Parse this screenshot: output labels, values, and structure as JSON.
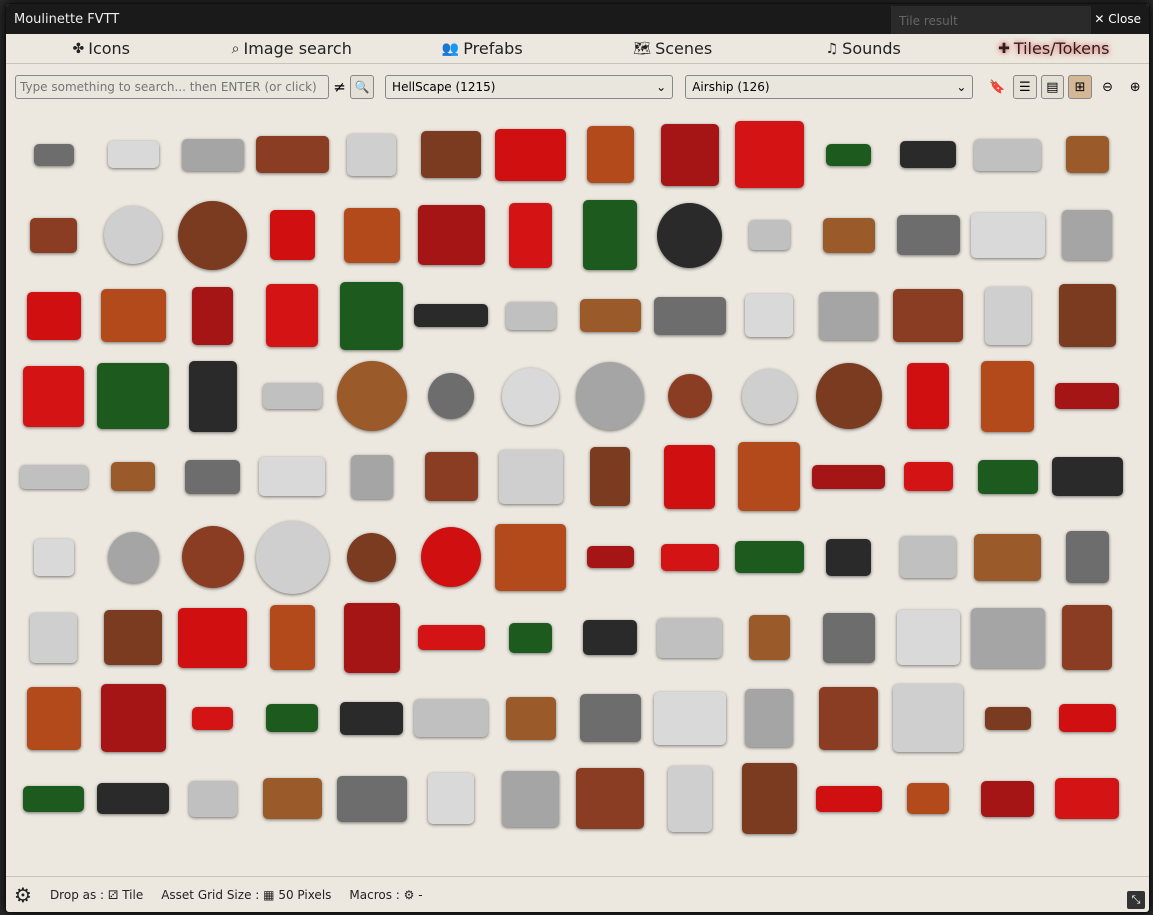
{
  "window": {
    "title": "Moulinette FVTT",
    "ghost_text": "Tile result",
    "close_label": "Close"
  },
  "tabs": [
    {
      "label": "Icons",
      "icon": "icons-icon"
    },
    {
      "label": "Image search",
      "icon": "search-icon"
    },
    {
      "label": "Prefabs",
      "icon": "users-icon"
    },
    {
      "label": "Scenes",
      "icon": "map-icon"
    },
    {
      "label": "Sounds",
      "icon": "music-icon"
    },
    {
      "label": "Tiles/Tokens",
      "icon": "puzzle-icon",
      "active": true
    }
  ],
  "toolbar": {
    "search_placeholder": "Type something to search... then ENTER (or click)",
    "neq": "≠",
    "pack": "HellScape (1215)",
    "category": "Airship (126)"
  },
  "grid": {
    "columns": 14,
    "rows": 9,
    "colors": [
      "#6d6d6d",
      "#d9d9d9",
      "#a5a5a5",
      "#8a3d22",
      "#cfcfcf",
      "#7a3b20",
      "#d01010",
      "#c1501a",
      "#a51515",
      "#d41414",
      "#cc1212",
      "#cf1212",
      "#d01414",
      "#1d5a1d"
    ]
  },
  "footer": {
    "drop_label": "Drop as :",
    "drop_value": "Tile",
    "grid_label": "Asset Grid Size :",
    "grid_value": "50 Pixels",
    "macros_label": "Macros :",
    "macros_value": "-"
  }
}
